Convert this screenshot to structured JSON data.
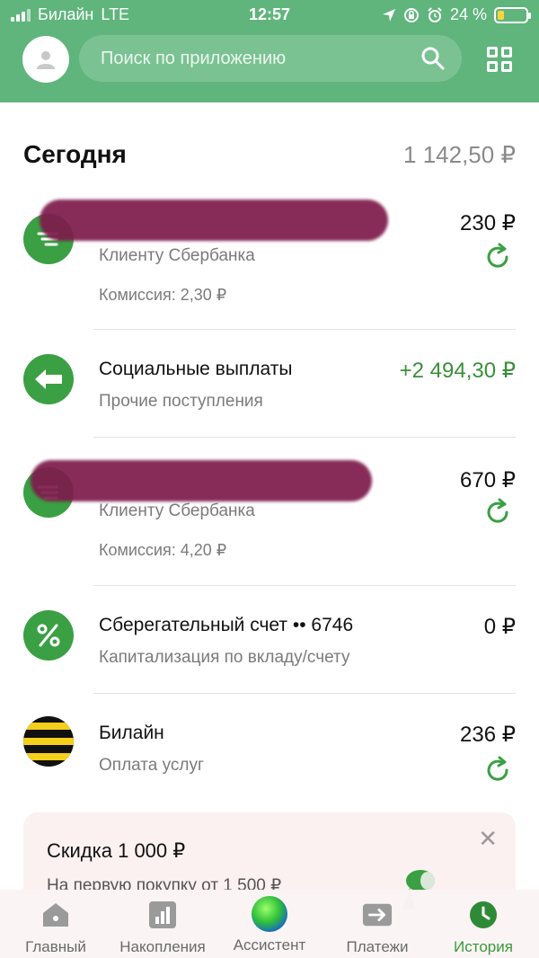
{
  "status_bar": {
    "carrier": "Билайн",
    "network": "LTE",
    "time": "12:57",
    "battery": "24 %",
    "battery_level": 0.24
  },
  "header": {
    "search_placeholder": "Поиск по приложению"
  },
  "section": {
    "title": "Сегодня",
    "total": "1 142,50 ₽"
  },
  "transactions": [
    {
      "title": "",
      "subtitle": "Клиенту Сбербанка",
      "fee": "Комиссия: 2,30 ₽",
      "amount": "230 ₽"
    },
    {
      "title": "Социальные выплаты",
      "subtitle": "Прочие поступления",
      "amount": "+2 494,30 ₽"
    },
    {
      "title": "",
      "subtitle": "Клиенту Сбербанка",
      "fee": "Комиссия: 4,20 ₽",
      "amount": "670 ₽"
    },
    {
      "title": "Сберегательный счет •• 6746",
      "subtitle": "Капитализация по вкладу/счету",
      "amount": "0 ₽"
    },
    {
      "title": "Билайн",
      "subtitle": "Оплата услуг",
      "amount": "236 ₽"
    }
  ],
  "promo": {
    "title": "Скидка 1 000 ₽",
    "text": "На первую покупку от 1 500 ₽"
  },
  "tabs": [
    {
      "label": "Главный"
    },
    {
      "label": "Накопления"
    },
    {
      "label": "Ассистент"
    },
    {
      "label": "Платежи"
    },
    {
      "label": "История"
    }
  ],
  "colors": {
    "header": "#5fb57c",
    "accent": "#3aa043",
    "redaction": "#7e1c4c",
    "beeline_yellow": "#f5cf1b"
  }
}
